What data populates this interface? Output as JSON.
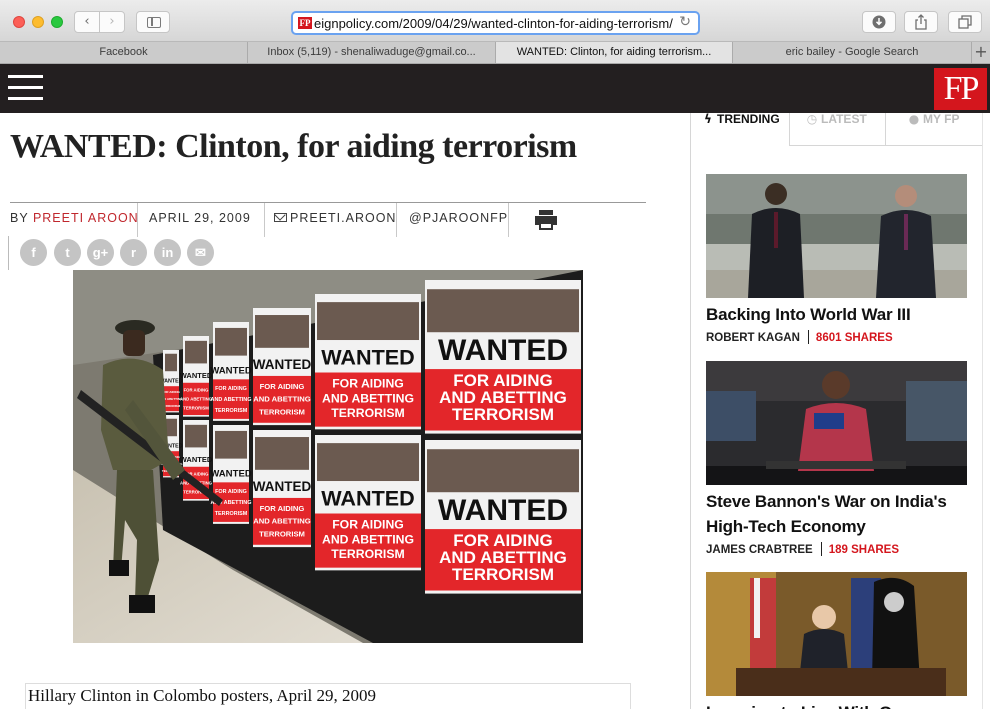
{
  "browser": {
    "url": "eignpolicy.com/2009/04/29/wanted-clinton-for-aiding-terrorism/",
    "favicon_text": "FP",
    "back_icon": "chevron-left-icon",
    "forward_icon": "chevron-right-icon",
    "reload_icon": "reload-icon",
    "tabs": [
      {
        "label": "Facebook"
      },
      {
        "label": "Inbox (5,119) - shenaliwaduge@gmail.co..."
      },
      {
        "label": "WANTED: Clinton, for aiding terrorism..."
      },
      {
        "label": "eric bailey - Google Search"
      }
    ],
    "add_tab_label": "+"
  },
  "site": {
    "logo": "FP",
    "brand_color": "#d4161d",
    "header_color": "#231f20"
  },
  "article": {
    "headline": "WANTED: Clinton, for aiding terrorism",
    "byline_prefix": "BY",
    "author": "PREETI AROON",
    "date": "APRIL 29, 2009",
    "email": "PREETI.AROON",
    "twitter": "@PJAROONFP",
    "share_icons": [
      {
        "icon": "facebook-icon",
        "glyph": "f"
      },
      {
        "icon": "twitter-icon",
        "glyph": "t"
      },
      {
        "icon": "google-plus-icon",
        "glyph": "g+"
      },
      {
        "icon": "reddit-icon",
        "glyph": "r"
      },
      {
        "icon": "linkedin-icon",
        "glyph": "in"
      },
      {
        "icon": "email-icon",
        "glyph": "✉"
      }
    ],
    "poster_word": "WANTED",
    "poster_tag_lines": [
      "FOR AIDING",
      "AND ABETTING",
      "TERRORISM"
    ],
    "caption": "Hillary Clinton in Colombo posters, April 29, 2009"
  },
  "sidebar": {
    "tabs": [
      {
        "label": "TRENDING",
        "icon": "lightning-icon"
      },
      {
        "label": "LATEST",
        "icon": "clock-icon"
      },
      {
        "label": "MY FP",
        "icon": "user-icon"
      }
    ],
    "stories": [
      {
        "title": "Backing Into World War III",
        "author": "ROBERT KAGAN",
        "shares": "8601 SHARES"
      },
      {
        "title": "Steve Bannon's War on India's High-Tech Economy",
        "author": "JAMES CRABTREE",
        "shares": "189 SHARES"
      },
      {
        "title": "Learning to Live With Our",
        "author": "",
        "shares": ""
      }
    ]
  }
}
